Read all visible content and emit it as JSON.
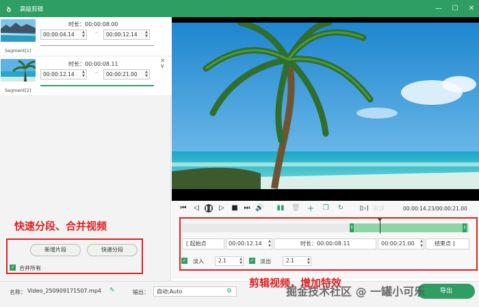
{
  "window": {
    "title": "高级剪辑",
    "minimize": "—",
    "maximize": "☐",
    "close": "✕"
  },
  "segments": [
    {
      "label": "Segment[1]",
      "duration_label": "时长：00:00:08.00",
      "start": "00:00:04.14",
      "end": "00:00:12.14"
    },
    {
      "label": "Segment[2]",
      "duration_label": "时长：00:00:08.11",
      "start": "00:00:12.14",
      "end": "00:00:21.00"
    }
  ],
  "left_caption": "快速分段、合并视频",
  "buttons": {
    "new_segment": "新增片段",
    "quick_split": "快速分段"
  },
  "merge_all": "合并所有",
  "player": {
    "time": "00:00:14.23/00:00:21.00"
  },
  "editor": {
    "start_point": "[   起始点",
    "start_value": "00:00:12.14",
    "duration_label": "时长：00:00:08.11",
    "end_value": "00:00:21.00",
    "end_point": "结束点   ]",
    "fade_in_label": "淡入",
    "fade_in_value": "2.1",
    "fade_out_label": "淡出",
    "fade_out_value": "2.1"
  },
  "right_caption": "剪辑视频，增加特效",
  "bottom": {
    "name_label": "名称：",
    "name_value": "Video_250909171507.mp4",
    "output_label": "输出：",
    "output_value": "自动;Auto",
    "export_label": "导出"
  },
  "watermark": "掘金技术社区 @ 一罐小可乐",
  "colors": {
    "accent": "#2f9e63",
    "annotation": "#e02020"
  },
  "icons": [
    "app-logo-icon",
    "edit-icon",
    "gear-icon",
    "first-frame-icon",
    "prev-frame-icon",
    "pause-icon",
    "next-frame-icon",
    "stop-icon",
    "volume-icon",
    "split-icon",
    "delete-icon",
    "add-icon",
    "copy-icon",
    "refresh-icon",
    "crop-icon",
    "screenshot-icon",
    "close-icon"
  ]
}
